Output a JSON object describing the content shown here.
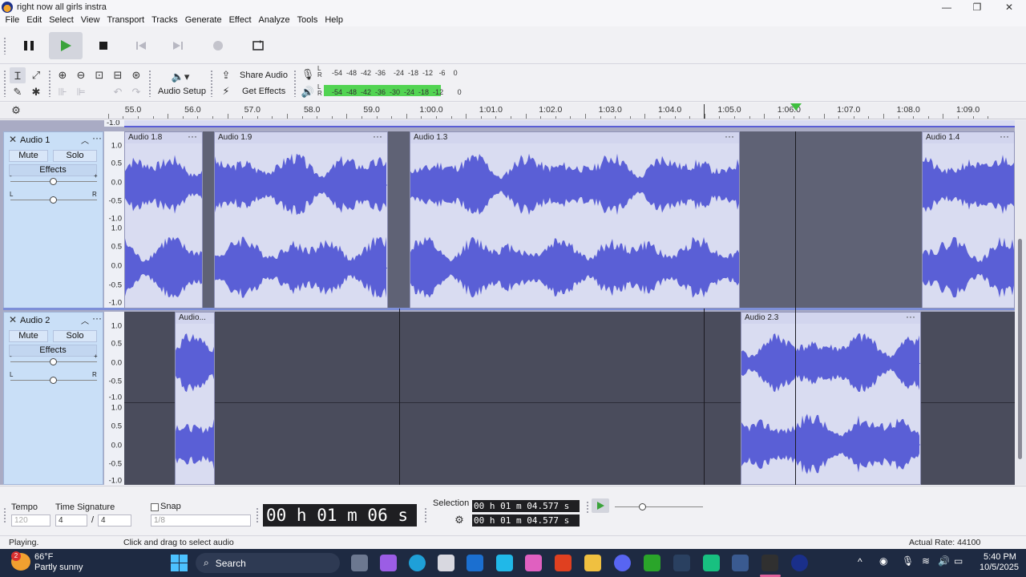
{
  "window": {
    "title": "right now all girls instra",
    "minimize": "—",
    "maximize": "❐",
    "close": "✕"
  },
  "menu": [
    "File",
    "Edit",
    "Select",
    "View",
    "Transport",
    "Tracks",
    "Generate",
    "Effect",
    "Analyze",
    "Tools",
    "Help"
  ],
  "toolbar": {
    "audio_setup": "Audio Setup",
    "share_audio": "Share Audio",
    "get_effects": "Get Effects",
    "rec_meter_label": "L\nR",
    "play_meter_label": "L\nR",
    "rec_meter_scale": "-54  -48  -42  -36    -24  -18  -12   -6    0",
    "play_meter_scale": "-54  -48  -42  -36  -30  -24  -18  -12       0"
  },
  "ruler": {
    "labels": [
      "55.0",
      "56.0",
      "57.0",
      "58.0",
      "59.0",
      "1:00.0",
      "1:01.0",
      "1:02.0",
      "1:03.0",
      "1:04.0",
      "1:05.0",
      "1:06.0",
      "1:07.0",
      "1:08.0",
      "1:09.0"
    ]
  },
  "scale_labels": [
    "1.0",
    "0.5",
    "0.0",
    "-0.5",
    "-1.0"
  ],
  "tracks": [
    {
      "name": "Audio 1",
      "mute": "Mute",
      "solo": "Solo",
      "effects": "Effects",
      "clips": [
        "Audio 1.8",
        "Audio 1.9",
        "Audio 1.3",
        "Audio 1.4"
      ]
    },
    {
      "name": "Audio 2",
      "mute": "Mute",
      "solo": "Solo",
      "effects": "Effects",
      "clips": [
        "Audio...",
        "Audio 2.3"
      ]
    }
  ],
  "bottom": {
    "tempo_label": "Tempo",
    "tempo_value": "120",
    "time_sig_label": "Time Signature",
    "time_sig_num": "4",
    "time_sig_sep": "/",
    "time_sig_den": "4",
    "snap_label": "Snap",
    "snap_value": "1/8",
    "time_display": "00 h 01 m 06 s",
    "selection_label": "Selection",
    "selection_start": "00 h 01 m 04.577 s",
    "selection_end": "00 h 01 m 04.577 s"
  },
  "status": {
    "state": "Playing.",
    "hint": "Click and drag to select audio",
    "rate": "Actual Rate: 44100"
  },
  "taskbar": {
    "weather_temp": "66°F",
    "weather_desc": "Partly sunny",
    "weather_badge": "2",
    "search": "Search",
    "time": "5:40 PM",
    "date": "10/5/2025"
  },
  "colors": {
    "waveform": "#5a5fd6",
    "clip_bg": "#d9dcf1",
    "track_ctl": "#c9dff7",
    "accent_green": "#52d452",
    "play_green": "#3aa33a"
  }
}
